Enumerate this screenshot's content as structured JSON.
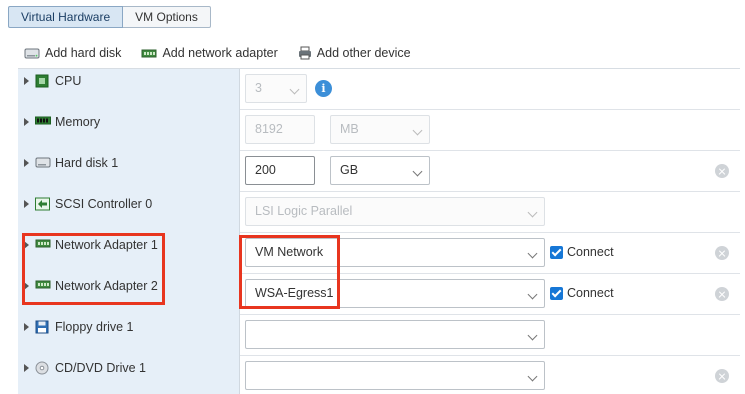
{
  "tabs": {
    "virtual_hardware": "Virtual Hardware",
    "vm_options": "VM Options"
  },
  "toolbar": {
    "add_hard_disk": "Add hard disk",
    "add_network_adapter": "Add network adapter",
    "add_other_device": "Add other device"
  },
  "rows": {
    "cpu": {
      "label": "CPU",
      "value": "3"
    },
    "memory": {
      "label": "Memory",
      "value": "8192",
      "unit": "MB"
    },
    "hard_disk": {
      "label": "Hard disk 1",
      "value": "200",
      "unit": "GB"
    },
    "scsi": {
      "label": "SCSI Controller 0",
      "value": "LSI Logic Parallel"
    },
    "net1": {
      "label": "Network Adapter 1",
      "network": "VM Network",
      "connect_label": "Connect",
      "connected": true
    },
    "net2": {
      "label": "Network Adapter 2",
      "network": "WSA-Egress1",
      "connect_label": "Connect",
      "connected": true
    },
    "floppy": {
      "label": "Floppy drive 1",
      "value": ""
    },
    "cdrom": {
      "label": "CD/DVD Drive 1",
      "value": ""
    }
  },
  "colors": {
    "highlight": "#e8351f",
    "checkbox": "#1677d6",
    "active_tab": "#d8e6f3",
    "row_label_bg": "#e6eff8"
  }
}
